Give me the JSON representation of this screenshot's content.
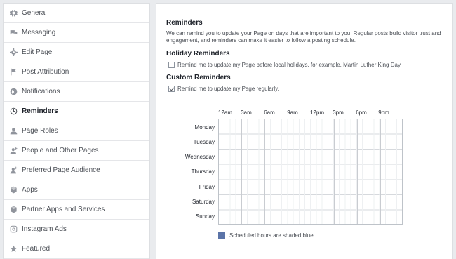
{
  "sidebar": {
    "items": [
      {
        "label": "General",
        "icon": "gear-icon",
        "active": false
      },
      {
        "label": "Messaging",
        "icon": "chat-bubbles-icon",
        "active": false
      },
      {
        "label": "Edit Page",
        "icon": "gear-icon",
        "active": false
      },
      {
        "label": "Post Attribution",
        "icon": "flag-icon",
        "active": false
      },
      {
        "label": "Notifications",
        "icon": "globe-icon",
        "active": false
      },
      {
        "label": "Reminders",
        "icon": "clock-icon",
        "active": true
      },
      {
        "label": "Page Roles",
        "icon": "person-icon",
        "active": false
      },
      {
        "label": "People and Other Pages",
        "icon": "person-plus-icon",
        "active": false
      },
      {
        "label": "Preferred Page Audience",
        "icon": "person-plus-icon",
        "active": false
      },
      {
        "label": "Apps",
        "icon": "cube-icon",
        "active": false
      },
      {
        "label": "Partner Apps and Services",
        "icon": "cube-icon",
        "active": false
      },
      {
        "label": "Instagram Ads",
        "icon": "instagram-icon",
        "active": false
      },
      {
        "label": "Featured",
        "icon": "star-icon",
        "active": false
      }
    ]
  },
  "main": {
    "title": "Reminders",
    "description": "We can remind you to update your Page on days that are important to you. Regular posts build visitor trust and engagement, and reminders can make it easier to follow a posting schedule.",
    "holiday": {
      "heading": "Holiday Reminders",
      "checkbox_label": "Remind me to update my Page before local holidays, for example, Martin Luther King Day.",
      "checked": false
    },
    "custom": {
      "heading": "Custom Reminders",
      "checkbox_label": "Remind me to update my Page regularly.",
      "checked": true
    },
    "schedule": {
      "hours": [
        "12am",
        "3am",
        "6am",
        "9am",
        "12pm",
        "3pm",
        "6pm",
        "9pm"
      ],
      "days": [
        "Monday",
        "Tuesday",
        "Wednesday",
        "Thursday",
        "Friday",
        "Saturday",
        "Sunday"
      ],
      "legend": "Scheduled hours are shaded blue",
      "shaded_color": "#5b74a8"
    }
  }
}
